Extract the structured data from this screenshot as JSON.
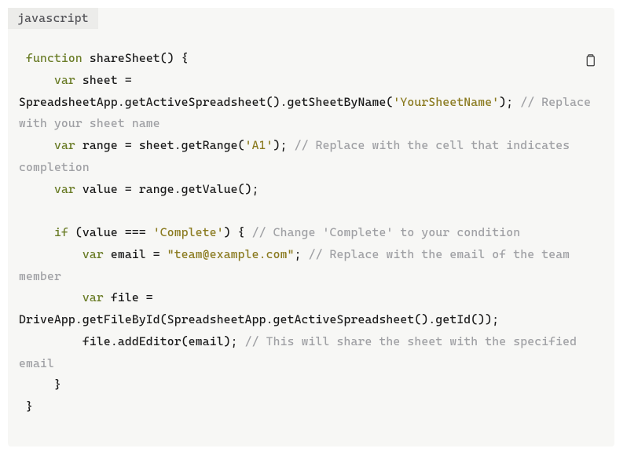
{
  "language_label": "javascript",
  "copy_title": "Copy",
  "tokens": [
    {
      "cls": "pln",
      "txt": " "
    },
    {
      "cls": "kw",
      "txt": "function"
    },
    {
      "cls": "pln",
      "txt": " shareSheet() {\n     "
    },
    {
      "cls": "kw",
      "txt": "var"
    },
    {
      "cls": "pln",
      "txt": " sheet = SpreadsheetApp.getActiveSpreadsheet().getSheetByName("
    },
    {
      "cls": "str",
      "txt": "'YourSheetName'"
    },
    {
      "cls": "pln",
      "txt": "); "
    },
    {
      "cls": "cmt",
      "txt": "// Replace with your sheet name"
    },
    {
      "cls": "pln",
      "txt": "\n     "
    },
    {
      "cls": "kw",
      "txt": "var"
    },
    {
      "cls": "pln",
      "txt": " range = sheet.getRange("
    },
    {
      "cls": "str",
      "txt": "'A1'"
    },
    {
      "cls": "pln",
      "txt": "); "
    },
    {
      "cls": "cmt",
      "txt": "// Replace with the cell that indicates completion"
    },
    {
      "cls": "pln",
      "txt": "\n     "
    },
    {
      "cls": "kw",
      "txt": "var"
    },
    {
      "cls": "pln",
      "txt": " value = range.getValue();\n\n     "
    },
    {
      "cls": "kw",
      "txt": "if"
    },
    {
      "cls": "pln",
      "txt": " (value === "
    },
    {
      "cls": "str",
      "txt": "'Complete'"
    },
    {
      "cls": "pln",
      "txt": ") { "
    },
    {
      "cls": "cmt",
      "txt": "// Change 'Complete' to your condition"
    },
    {
      "cls": "pln",
      "txt": "\n         "
    },
    {
      "cls": "kw",
      "txt": "var"
    },
    {
      "cls": "pln",
      "txt": " email = "
    },
    {
      "cls": "str",
      "txt": "\"team@example.com\""
    },
    {
      "cls": "pln",
      "txt": "; "
    },
    {
      "cls": "cmt",
      "txt": "// Replace with the email of the team member"
    },
    {
      "cls": "pln",
      "txt": "\n         "
    },
    {
      "cls": "kw",
      "txt": "var"
    },
    {
      "cls": "pln",
      "txt": " file = DriveApp.getFileById(SpreadsheetApp.getActiveSpreadsheet().getId());\n         file.addEditor(email); "
    },
    {
      "cls": "cmt",
      "txt": "// This will share the sheet with the specified email"
    },
    {
      "cls": "pln",
      "txt": "\n     }\n }"
    }
  ]
}
